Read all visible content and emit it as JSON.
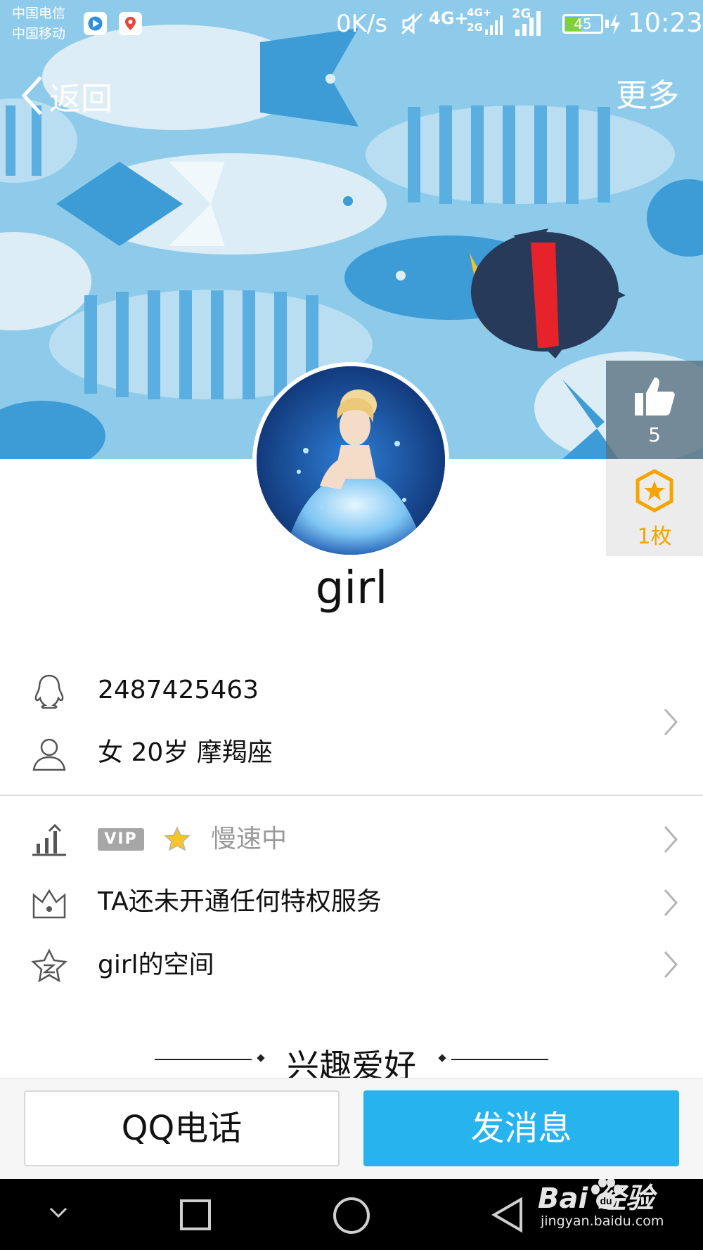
{
  "status_bar": {
    "carrier_1": "中国电信",
    "carrier_2": "中国移动",
    "net_speed": "0K/s",
    "signal_1": "4G+",
    "signal_2_top": "4G+",
    "signal_2_bottom": "2G",
    "signal_3": "2G",
    "battery": "45",
    "time": "10:23"
  },
  "nav": {
    "back_label": "返回",
    "more_label": "更多"
  },
  "side_panel": {
    "like_count": "5",
    "badge_count": "1枚"
  },
  "profile": {
    "nickname": "girl",
    "qq_number": "2487425463",
    "basic_info": "女  20岁  摩羯座",
    "vip_label": "VIP",
    "vip_status": "慢速中",
    "privilege_text": "TA还未开通任何特权服务",
    "space_text": "girl的空间"
  },
  "section": {
    "hobbies_title": "兴趣爱好"
  },
  "actions": {
    "call_label": "QQ电话",
    "message_label": "发消息"
  },
  "watermark": {
    "brand": "Bai  经验",
    "url": "jingyan.baidu.com"
  },
  "colors": {
    "accent": "#27b3ee",
    "banner": "#8ecbea",
    "badge": "#f5a400",
    "battery": "#7fd13b"
  },
  "icons": {
    "back": "chevron-left-icon",
    "like": "thumbs-up-icon",
    "badge": "star-hexagon-icon",
    "qq": "qq-penguin-icon",
    "person": "person-icon",
    "level": "level-chart-icon",
    "privilege": "crown-icon",
    "space": "qzone-star-icon"
  }
}
